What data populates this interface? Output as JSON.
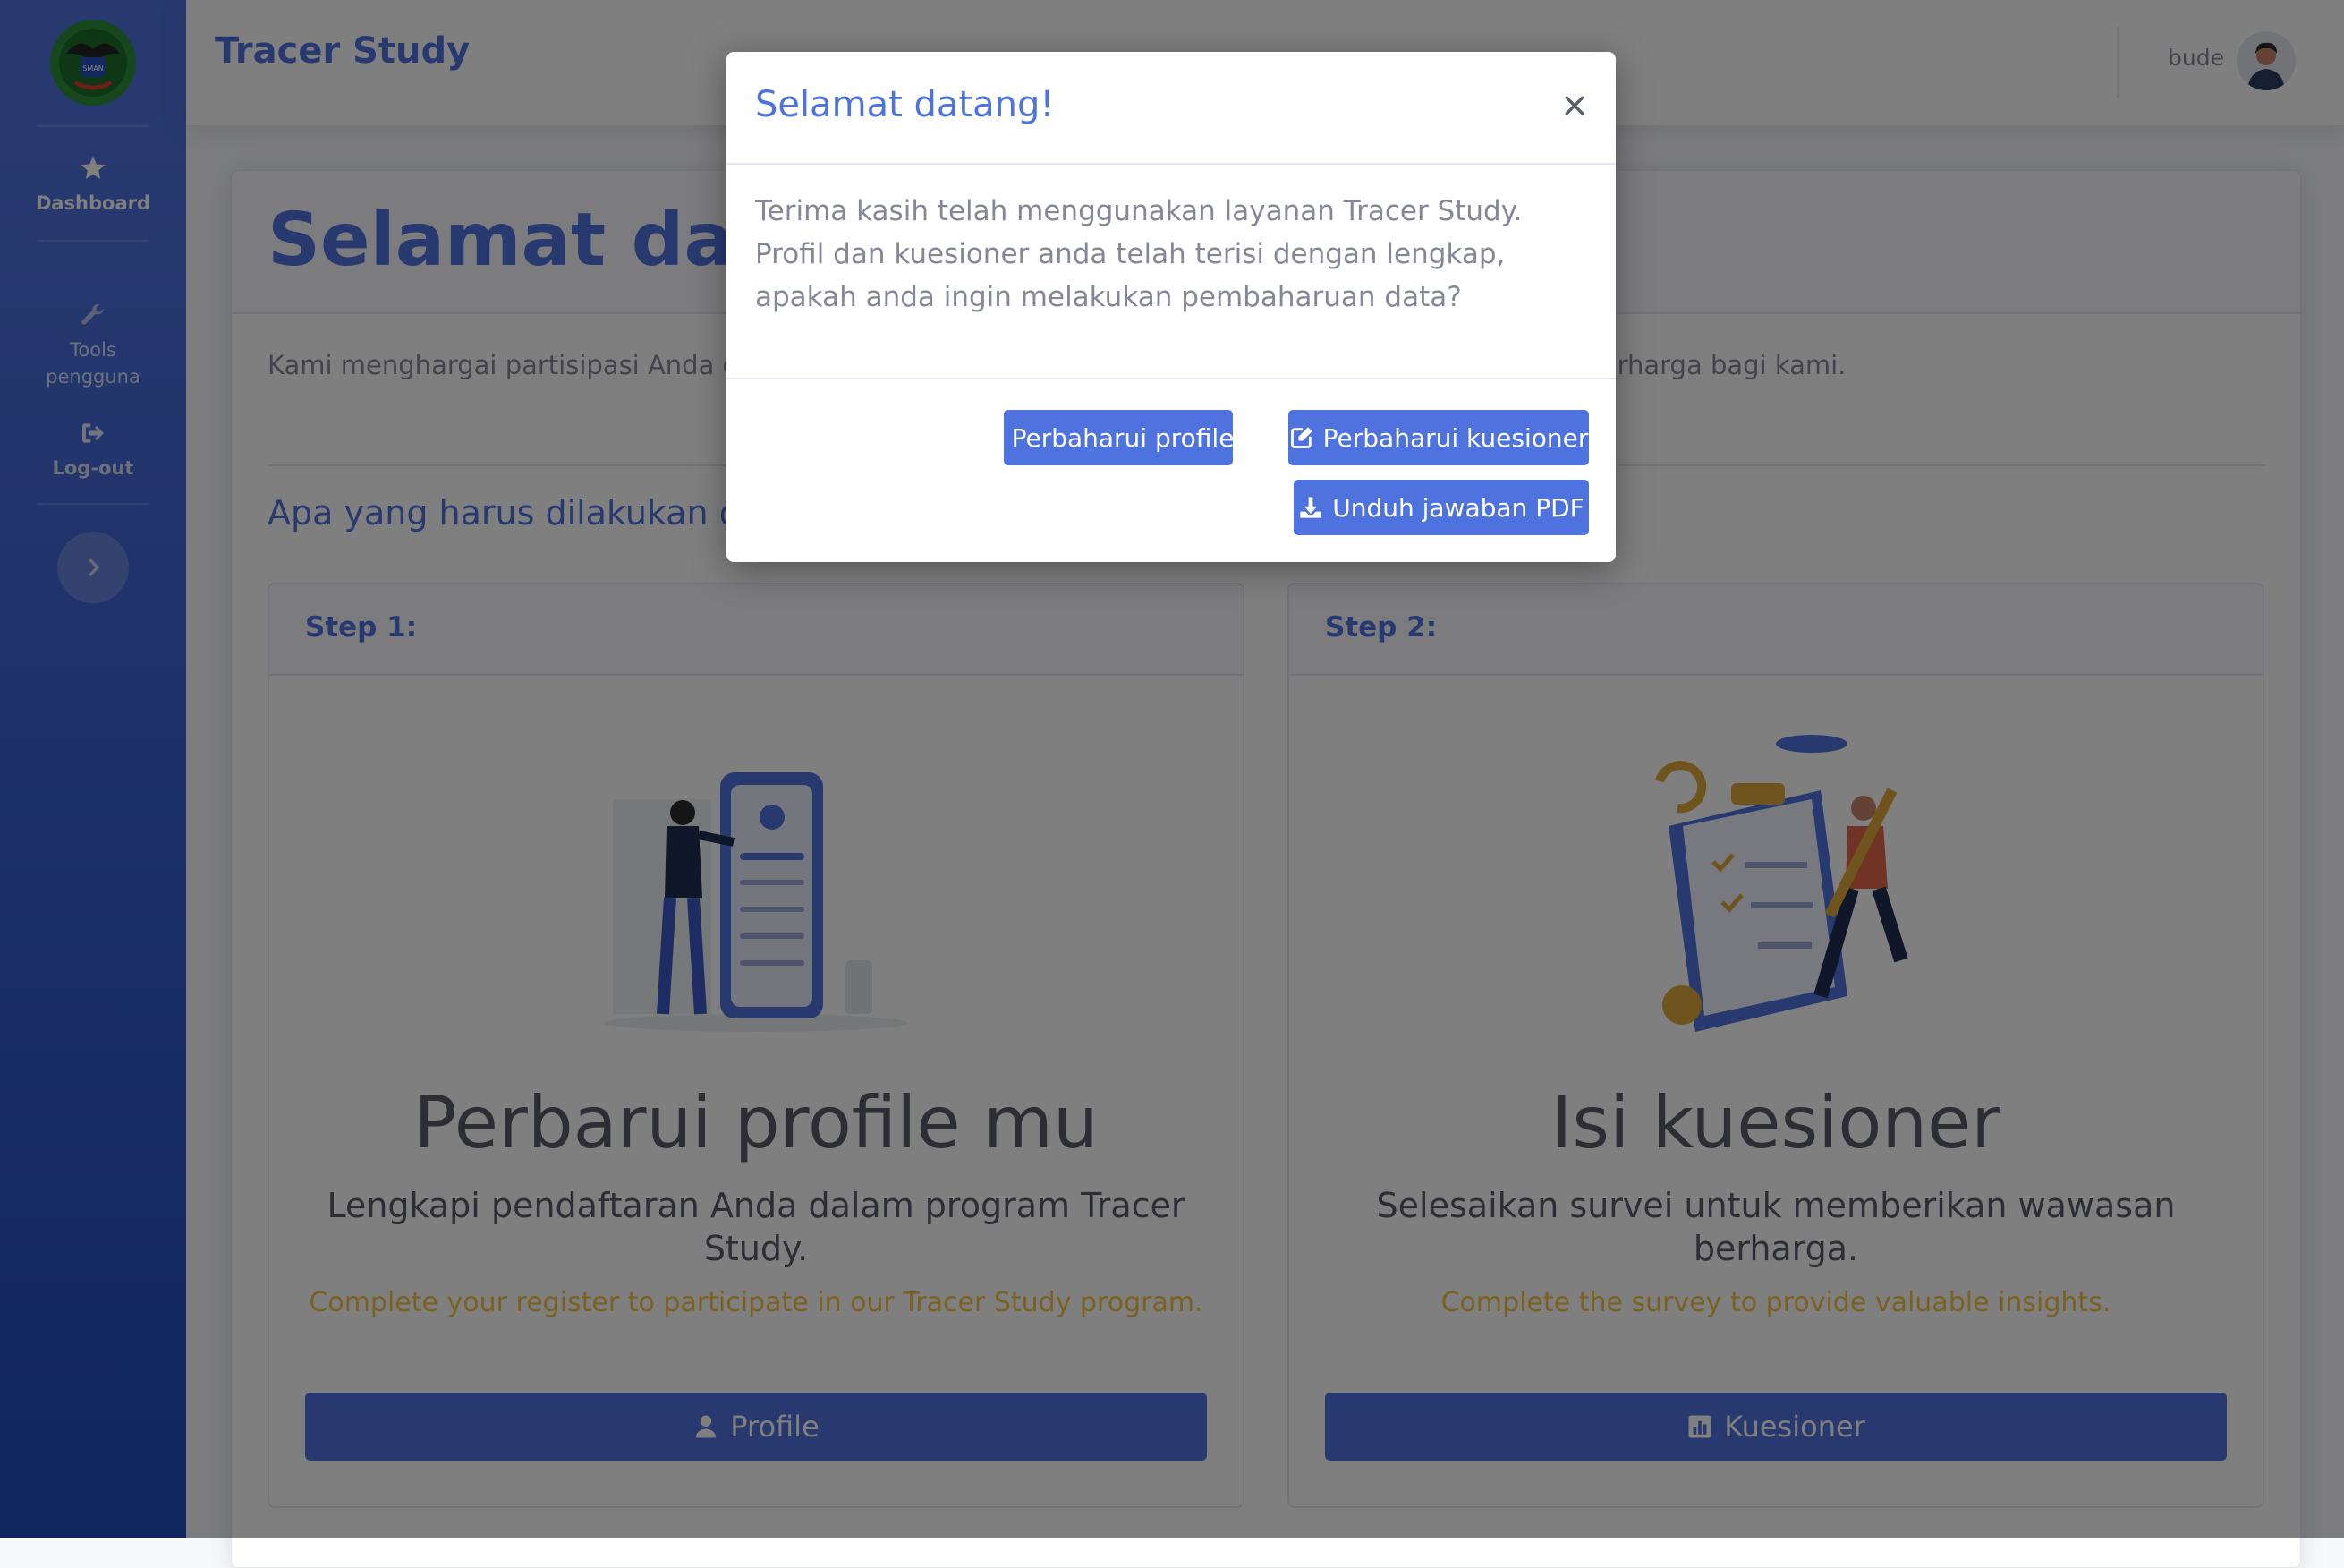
{
  "app": {
    "title": "Tracer Study"
  },
  "sidebar": {
    "items": [
      {
        "label": "Dashboard",
        "icon": "star-icon"
      },
      {
        "label": "Tools pengguna",
        "icon": "wrench-icon"
      },
      {
        "label": "Log-out",
        "icon": "sign-out-icon"
      }
    ]
  },
  "user": {
    "name": "bude"
  },
  "main": {
    "title": "Selamat datang!",
    "intro": "Kami menghargai partisipasi Anda dalam program Tracer Study. Informasi yang Anda berikan sangat berharga bagi kami.",
    "subheading": "Apa yang harus dilakukan di Tracer Study?",
    "steps": [
      {
        "label": "Step 1:",
        "title": "Perbarui profile mu",
        "description": "Lengkapi pendaftaran Anda dalam program Tracer Study.",
        "english": "Complete your register to participate in our Tracer Study program.",
        "button": "Profile",
        "button_icon": "user-icon"
      },
      {
        "label": "Step 2:",
        "title": "Isi kuesioner",
        "description": "Selesaikan survei untuk memberikan wawasan berharga.",
        "english": "Complete the survey to provide valuable insights.",
        "button": "Kuesioner",
        "button_icon": "chart-bar-icon"
      }
    ]
  },
  "modal": {
    "title": "Selamat datang!",
    "body": "Terima kasih telah menggunakan layanan Tracer Study. Profil dan kuesioner anda telah terisi dengan lengkap, apakah anda ingin melakukan pembaharuan data?",
    "buttons": [
      {
        "label": "Perbaharui profile",
        "icon": "user-edit-icon"
      },
      {
        "label": "Perbaharui kuesioner",
        "icon": "edit-icon"
      },
      {
        "label": "Unduh jawaban PDF",
        "icon": "download-icon"
      }
    ]
  },
  "colors": {
    "primary": "#4e73df",
    "warning": "#f6c23e",
    "text": "#858796",
    "heading": "#5a5c69"
  }
}
